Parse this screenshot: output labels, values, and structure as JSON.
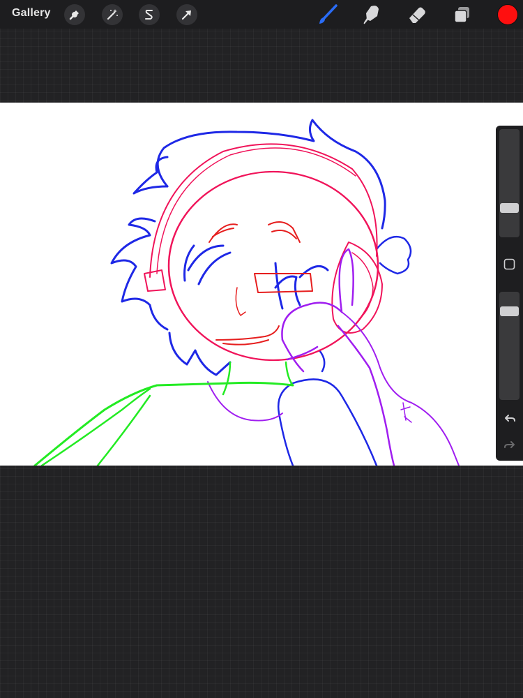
{
  "toolbar": {
    "gallery_label": "Gallery",
    "actions_icon": "wrench-icon",
    "adjustments_icon": "magic-wand-icon",
    "selection_icon": "selection-s-icon",
    "transform_icon": "arrow-cursor-icon",
    "brush_icon": "brush-icon",
    "smudge_icon": "smudge-finger-icon",
    "eraser_icon": "eraser-icon",
    "layers_icon": "layers-icon",
    "current_color": "#ff0f0f",
    "active_tool": "brush",
    "active_tool_color": "#2a6cf6"
  },
  "sidebar": {
    "brush_size_level": 0.45,
    "opacity_level": 0.18,
    "modify_icon": "square-modify-icon",
    "undo_icon": "undo-icon",
    "redo_icon": "redo-icon"
  },
  "artwork": {
    "stroke_colors": [
      "#1e28e6",
      "#f0145a",
      "#e61e1e",
      "#a01ef0",
      "#23eb23"
    ]
  }
}
